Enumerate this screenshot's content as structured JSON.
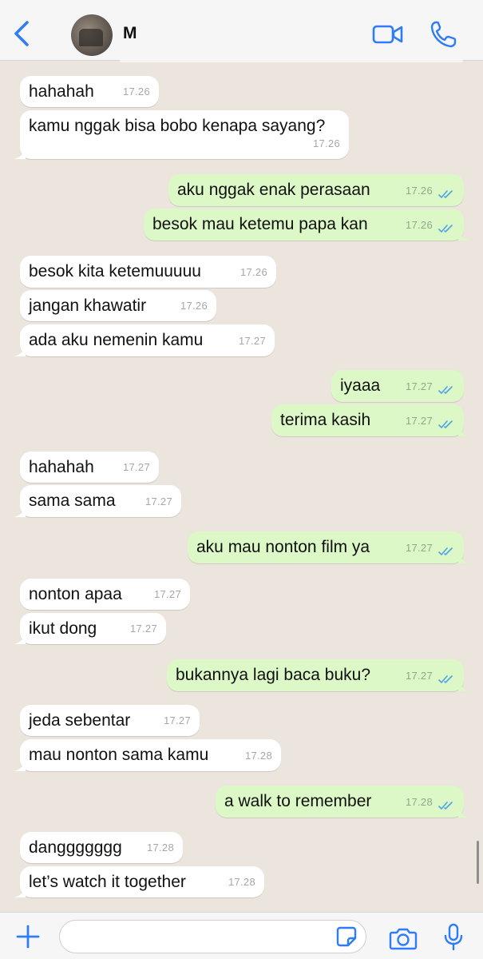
{
  "header": {
    "contact_name": "M"
  },
  "messages": [
    {
      "dir": "in",
      "text": "hahahah",
      "time": "17.26"
    },
    {
      "dir": "in",
      "text": "kamu nggak bisa bobo kenapa sayang?",
      "time": "17.26"
    },
    {
      "dir": "out",
      "text": "aku nggak enak perasaan",
      "time": "17.26"
    },
    {
      "dir": "out",
      "text": "besok mau ketemu papa kan",
      "time": "17.26"
    },
    {
      "dir": "in",
      "text": "besok kita ketemuuuuu",
      "time": "17.26"
    },
    {
      "dir": "in",
      "text": "jangan khawatir",
      "time": "17.26"
    },
    {
      "dir": "in",
      "text": "ada aku nemenin kamu",
      "time": "17.27"
    },
    {
      "dir": "out",
      "text": "iyaaa",
      "time": "17.27"
    },
    {
      "dir": "out",
      "text": "terima kasih",
      "time": "17.27"
    },
    {
      "dir": "in",
      "text": "hahahah",
      "time": "17.27"
    },
    {
      "dir": "in",
      "text": "sama sama",
      "time": "17.27"
    },
    {
      "dir": "out",
      "text": "aku mau nonton film ya",
      "time": "17.27"
    },
    {
      "dir": "in",
      "text": "nonton apaa",
      "time": "17.27"
    },
    {
      "dir": "in",
      "text": "ikut dong",
      "time": "17.27"
    },
    {
      "dir": "out",
      "text": "bukannya lagi baca buku?",
      "time": "17.27"
    },
    {
      "dir": "in",
      "text": "jeda sebentar",
      "time": "17.27"
    },
    {
      "dir": "in",
      "text": "mau nonton sama kamu",
      "time": "17.28"
    },
    {
      "dir": "out",
      "text": "a walk to remember",
      "time": "17.28"
    },
    {
      "dir": "in",
      "text": "danggggggg",
      "time": "17.28"
    },
    {
      "dir": "in",
      "text": "let’s watch it together",
      "time": "17.28"
    }
  ],
  "input": {
    "value": "",
    "placeholder": ""
  },
  "icons": {
    "back": "chevron-left-icon",
    "video": "video-camera-icon",
    "call": "phone-icon",
    "plus": "plus-icon",
    "sticker": "sticker-icon",
    "camera": "camera-icon",
    "mic": "microphone-icon"
  },
  "colors": {
    "accent": "#2f7cf6",
    "chat_background": "#ece5dd",
    "incoming_bubble": "#ffffff",
    "outgoing_bubble": "#dcf8c6",
    "read_ticks": "#4fa3e6"
  }
}
